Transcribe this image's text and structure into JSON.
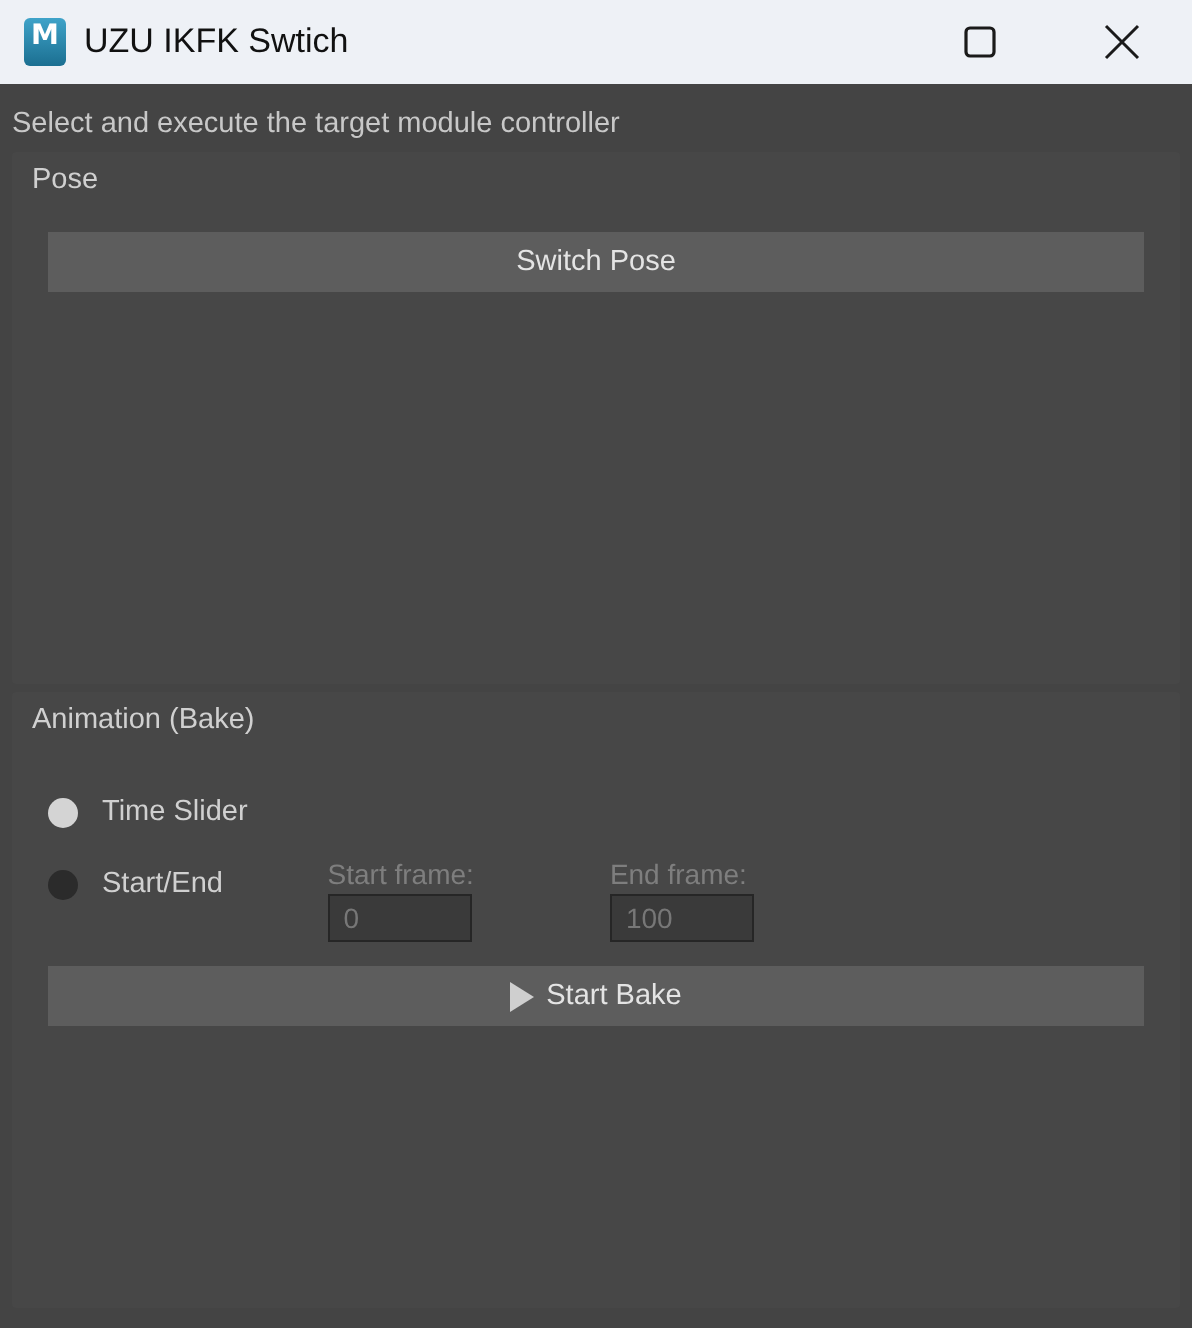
{
  "window": {
    "title": "UZU IKFK Swtich",
    "icon_letter": "M"
  },
  "description": "Select and execute the target module controller",
  "pose": {
    "title": "Pose",
    "button": "Switch Pose"
  },
  "animation": {
    "title": "Animation (Bake)",
    "options": [
      {
        "label": "Time Slider",
        "selected": true
      },
      {
        "label": "Start/End",
        "selected": false
      }
    ],
    "fields": [
      {
        "label": "Start frame:",
        "value": "0",
        "disabled": true
      },
      {
        "label": "End frame:",
        "value": "100",
        "disabled": true
      }
    ],
    "button": "Start Bake"
  }
}
